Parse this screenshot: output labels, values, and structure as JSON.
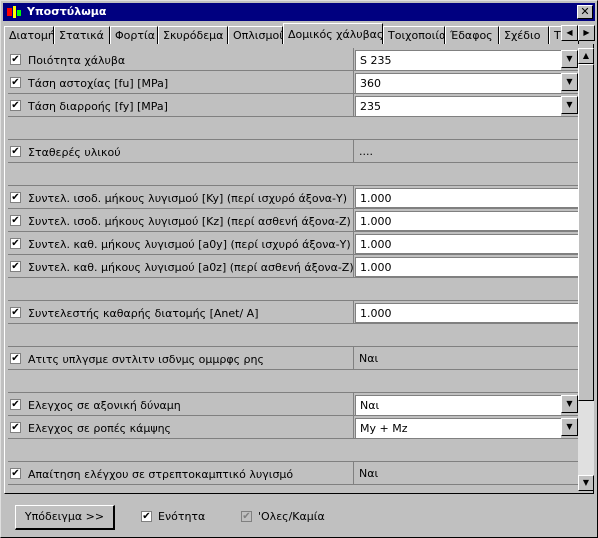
{
  "window": {
    "title": "Υποστύλωμα",
    "close_glyph": "✕",
    "title_color": "#000080"
  },
  "tabs": [
    {
      "label": "Διατομή",
      "active": false
    },
    {
      "label": "Στατικά",
      "active": false
    },
    {
      "label": "Φορτία",
      "active": false
    },
    {
      "label": "Σκυρόδεμα",
      "active": false
    },
    {
      "label": "Οπλισμοί",
      "active": false
    },
    {
      "label": "Δομικός χάλυβας",
      "active": true
    },
    {
      "label": "Τοιχοποιία",
      "active": false
    },
    {
      "label": "Έδαφος",
      "active": false
    },
    {
      "label": "Σχέδιο",
      "active": false
    },
    {
      "label": "Τρ",
      "active": false
    }
  ],
  "tab_scroll": {
    "left_glyph": "◀",
    "right_glyph": "▶"
  },
  "rows": [
    {
      "label": "Ποιότητα χάλυβα",
      "value": "S 235",
      "type": "combo",
      "checked": true
    },
    {
      "label": "Τάση αστοχίας [fu] [MPa]",
      "value": "360",
      "type": "combo",
      "checked": true
    },
    {
      "label": "Τάση διαρροής [fy] [MPa]",
      "value": "235",
      "type": "combo",
      "checked": true
    },
    {
      "type": "blank"
    },
    {
      "label": "Σταθερές υλικού",
      "value": "....",
      "type": "static",
      "checked": true
    },
    {
      "type": "blank"
    },
    {
      "label": "Συντελ. ισοδ. μήκους λυγισμού [Ky] (περί ισχυρό άξονα-Y)",
      "value": "1.000",
      "type": "edit",
      "checked": true
    },
    {
      "label": "Συντελ. ισοδ. μήκους λυγισμού [Kz] (περί ασθενή άξονα-Z)",
      "value": "1.000",
      "type": "edit",
      "checked": true
    },
    {
      "label": "Συντελ. καθ. μήκους λυγισμού [a0y] (περί ισχυρό άξονα-Y)",
      "value": "1.000",
      "type": "edit",
      "checked": true
    },
    {
      "label": "Συντελ. καθ. μήκους λυγισμού [a0z] (περί ασθενή άξονα-Z)",
      "value": "1.000",
      "type": "edit",
      "checked": true
    },
    {
      "type": "blank"
    },
    {
      "label": "Συντελεστής καθαρής διατομής [Anet/ A]",
      "value": "1.000",
      "type": "edit",
      "checked": true
    },
    {
      "type": "blank"
    },
    {
      "label": "Ατιτς υπλγσμε σντλιτν ισδνμς ομμρφς ρης",
      "value": "Ναι",
      "type": "static",
      "checked": true
    },
    {
      "type": "blank"
    },
    {
      "label": "Ελεγχος σε αξονική δύναμη",
      "value": "Ναι",
      "type": "combo",
      "checked": true
    },
    {
      "label": "Ελεγχος σε ροπές κάμψης",
      "value": "My + Mz",
      "type": "combo",
      "checked": true
    },
    {
      "type": "blank"
    },
    {
      "label": "Απαίτηση ελέγχου σε στρεπτοκαμπτικό λυγισμό",
      "value": "Ναι",
      "type": "static",
      "checked": true
    }
  ],
  "glyphs": {
    "check": "✔",
    "dropdown": "▼",
    "up": "▲",
    "down": "▼"
  },
  "scroll": {
    "position": 0.0,
    "visible_fraction": 0.82
  },
  "bottom": {
    "sample_button": "Υπόδειγμα >>",
    "unit_check": {
      "label": "Ενότητα",
      "checked": true
    },
    "all_check": {
      "label": "'Ολες/Καμία",
      "checked": true,
      "disabled": true
    }
  }
}
